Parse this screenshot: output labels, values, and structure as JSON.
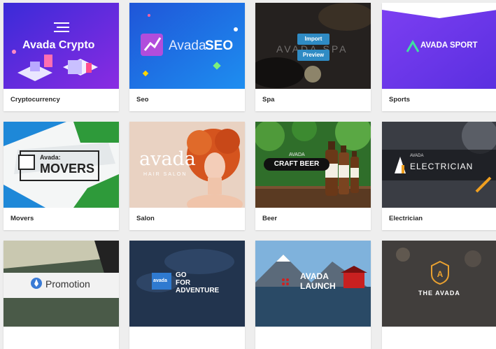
{
  "cards": [
    {
      "label": "Cryptocurrency",
      "thumb_title": "Avada Crypto"
    },
    {
      "label": "Seo",
      "thumb_title_a": "Avada",
      "thumb_title_b": "SEO"
    },
    {
      "label": "Spa",
      "thumb_title": "AVADA SPA",
      "import_label": "Import",
      "preview_label": "Preview"
    },
    {
      "label": "Sports",
      "thumb_title": "AVADA SPORT"
    },
    {
      "label": "Movers",
      "thumb_small": "Avada:",
      "thumb_title": "MOVERS"
    },
    {
      "label": "Salon",
      "thumb_title": "avada",
      "thumb_sub": "HAIR SALON"
    },
    {
      "label": "Beer",
      "thumb_small": "AVADA",
      "thumb_title": "CRAFT BEER"
    },
    {
      "label": "Electrician",
      "thumb_small": "AVADA",
      "thumb_title": "ELECTRICIAN"
    },
    {
      "label": "",
      "thumb_title": "Promotion"
    },
    {
      "label": "",
      "thumb_badge": "avada",
      "thumb_title_a": "GO",
      "thumb_title_b": "FOR",
      "thumb_title_c": "ADVENTURE"
    },
    {
      "label": "",
      "thumb_title_a": "AVADA",
      "thumb_title_b": "LAUNCH"
    },
    {
      "label": "",
      "thumb_title": "THE AVADA"
    }
  ],
  "colors": {
    "page_bg": "#eeeeee",
    "card_bg": "#ffffff",
    "label_text": "#2b2b2b",
    "button_blue": "#2f8bc4",
    "crypto_purple": "#5b2bd9",
    "seo_blue": "#1e6fe0",
    "sports_purple": "#6a3df0",
    "movers_green": "#2e9a3a",
    "electrician_orange": "#f0a020"
  },
  "icons": [
    "list-lines-icon",
    "chart-arrow-icon",
    "sport-logo-icon",
    "box-icon",
    "beer-bottle-icon",
    "plug-icon",
    "rocket-icon",
    "shield-badge-icon"
  ]
}
